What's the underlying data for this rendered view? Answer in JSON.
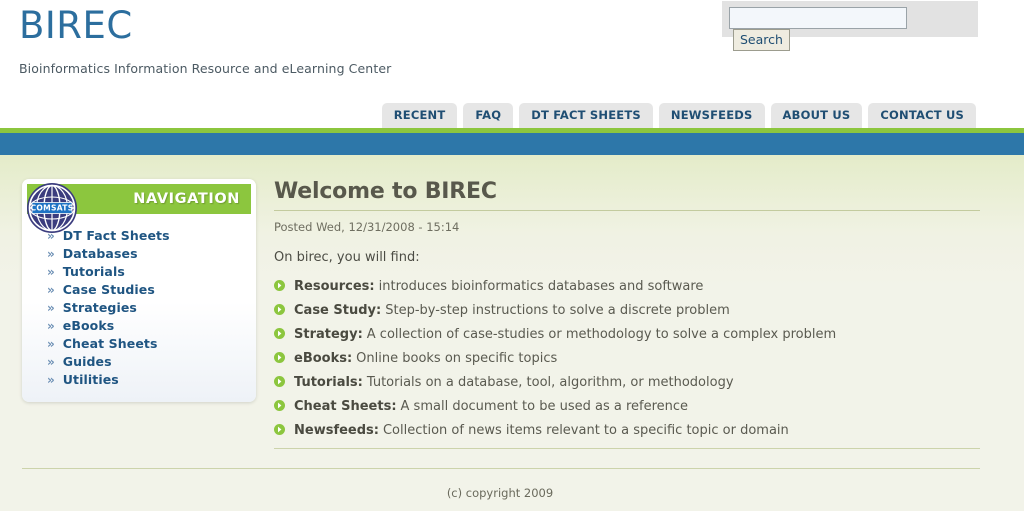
{
  "header": {
    "site_title": "BIREC",
    "site_slogan": "Bioinformatics Information Resource and eLearning Center",
    "search": {
      "value": "",
      "placeholder": "",
      "button_label": "Search",
      "icon": "search-icon"
    },
    "tabs": [
      {
        "label": "RECENT"
      },
      {
        "label": "FAQ"
      },
      {
        "label": "DT FACT SHEETS"
      },
      {
        "label": "NEWSFEEDS"
      },
      {
        "label": "ABOUT US"
      },
      {
        "label": "CONTACT US"
      }
    ]
  },
  "sidebar": {
    "block_title": "NAVIGATION",
    "logo": {
      "icon": "comsats-globe-logo",
      "label": "COMSATS"
    },
    "bullet_glyph": "»",
    "items": [
      {
        "label": "DT Fact Sheets"
      },
      {
        "label": "Databases"
      },
      {
        "label": "Tutorials"
      },
      {
        "label": "Case Studies"
      },
      {
        "label": "Strategies"
      },
      {
        "label": "eBooks"
      },
      {
        "label": "Cheat Sheets"
      },
      {
        "label": "Guides"
      },
      {
        "label": "Utilities"
      }
    ]
  },
  "main": {
    "page_title": "Welcome to BIREC",
    "submitted": "Posted Wed, 12/31/2008 - 15:14",
    "intro": "On birec, you will find:",
    "features": [
      {
        "term": "Resources:",
        "desc": "introduces bioinformatics databases and software"
      },
      {
        "term": "Case Study:",
        "desc": "Step-by-step instructions to solve a discrete problem"
      },
      {
        "term": "Strategy:",
        "desc": "A collection of case-studies or methodology to solve a complex problem"
      },
      {
        "term": "eBooks:",
        "desc": "Online books on specific topics"
      },
      {
        "term": "Tutorials:",
        "desc": "Tutorials on a database, tool, algorithm, or methodology"
      },
      {
        "term": "Cheat Sheets:",
        "desc": "A small document to be used as a reference"
      },
      {
        "term": "Newsfeeds:",
        "desc": "Collection of news items relevant to a specific topic or domain"
      }
    ]
  },
  "footer": {
    "copyright": "(c) copyright 2009"
  },
  "colors": {
    "brand_blue": "#2c6e9e",
    "bar_blue": "#2d77a9",
    "accent_green": "#8cc63e",
    "page_bg": "#f2f3e9",
    "link_blue": "#1f5582",
    "tab_bg": "#e6e6e6"
  }
}
